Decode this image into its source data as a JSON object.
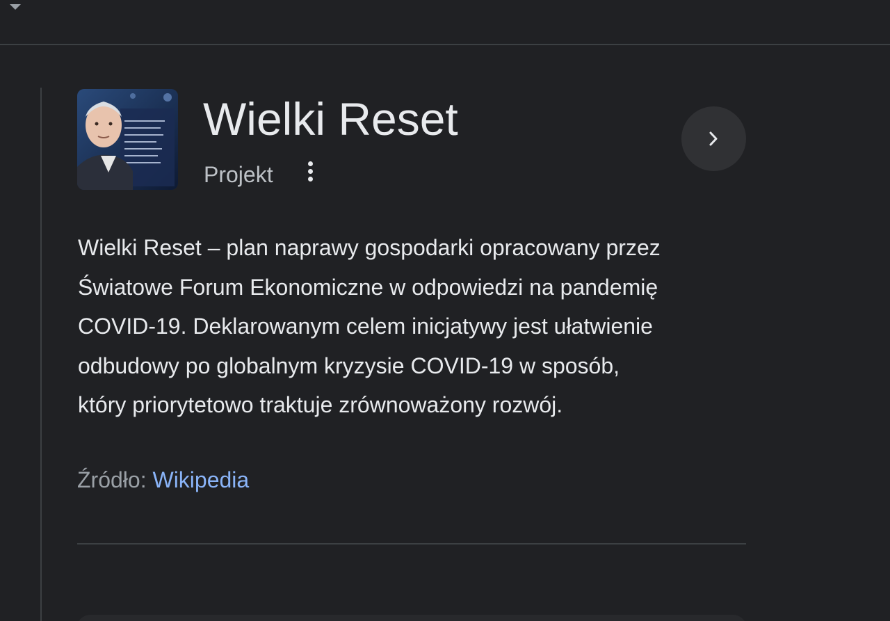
{
  "entity": {
    "title": "Wielki Reset",
    "type_label": "Projekt",
    "description_lines": [
      "Wielki Reset – plan naprawy gospodarki opracowany przez",
      "Światowe Forum Ekonomiczne w odpowiedzi na pandemię",
      "COVID-19. Deklarowanym celem inicjatywy jest ułatwienie",
      "odbudowy po globalnym kryzysie COVID-19 w sposób,",
      "który priorytetowo traktuje zrównoważony rozwój."
    ],
    "source_label": "Źródło: ",
    "source_link": "Wikipedia"
  },
  "icons": {
    "top_left": "caret-down-icon",
    "more": "more-vert-icon",
    "next": "chevron-right-icon"
  },
  "colors": {
    "background": "#202124",
    "title": "#e8eaed",
    "secondary": "#9aa0a6",
    "link": "#8ab4f8",
    "button_bg": "#303134"
  }
}
